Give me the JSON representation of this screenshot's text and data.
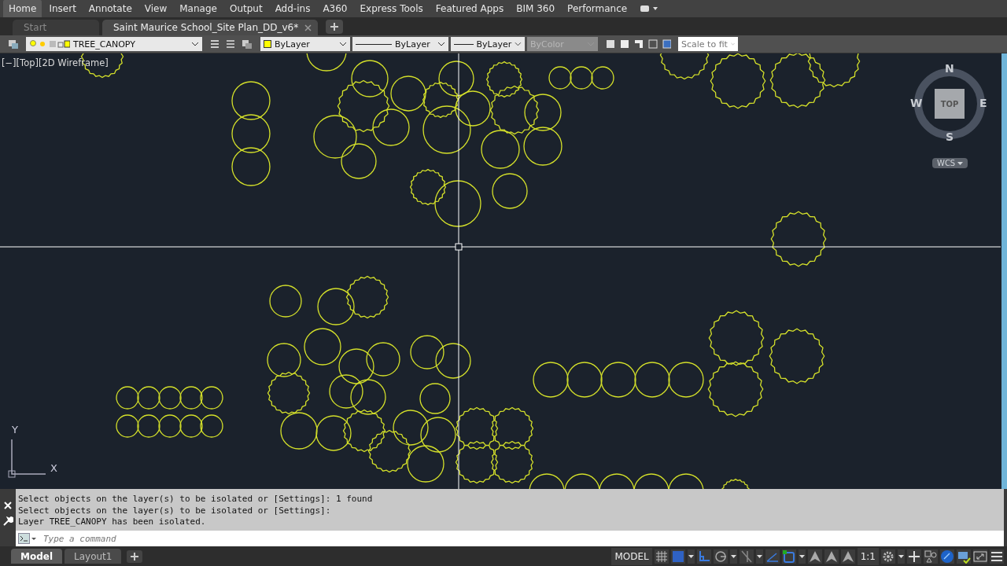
{
  "ribbon_tabs": [
    {
      "label": "Home",
      "selected": true
    },
    {
      "label": "Insert",
      "selected": false
    },
    {
      "label": "Annotate",
      "selected": false
    },
    {
      "label": "View",
      "selected": false
    },
    {
      "label": "Manage",
      "selected": false
    },
    {
      "label": "Output",
      "selected": false
    },
    {
      "label": "Add-ins",
      "selected": false
    },
    {
      "label": "A360",
      "selected": false
    },
    {
      "label": "Express Tools",
      "selected": false
    },
    {
      "label": "Featured Apps",
      "selected": false
    },
    {
      "label": "BIM 360",
      "selected": false
    },
    {
      "label": "Performance",
      "selected": false
    }
  ],
  "document_tabs": [
    {
      "label": "Start",
      "selected": false
    },
    {
      "label": "Saint Maurice School_Site Plan_DD_v6*",
      "selected": true
    }
  ],
  "properties_toolbar": {
    "layer": "TREE_CANOPY",
    "color_setting": "ByLayer",
    "linetype": "ByLayer",
    "lineweight": "ByLayer",
    "plot_style": {
      "value": "ByColor",
      "disabled": true
    },
    "scale": "Scale to fit"
  },
  "viewport_label": "[−][Top][2D Wireframe]",
  "viewcube": {
    "north": "N",
    "south": "S",
    "east": "E",
    "west": "W",
    "face": "TOP",
    "ucs": "WCS"
  },
  "ucs_icon": {
    "x": "X",
    "y": "Y"
  },
  "command_history": [
    "Select objects on the layer(s) to be isolated or [Settings]: 1 found",
    "Select objects on the layer(s) to be isolated or [Settings]:",
    "Layer TREE_CANOPY has been isolated."
  ],
  "command_line": {
    "placeholder": "Type a command"
  },
  "layout_tabs": [
    {
      "label": "Model",
      "selected": true
    },
    {
      "label": "Layout1",
      "selected": false
    }
  ],
  "status_bar": {
    "space": "MODEL",
    "annotation_scale": "1:1"
  }
}
